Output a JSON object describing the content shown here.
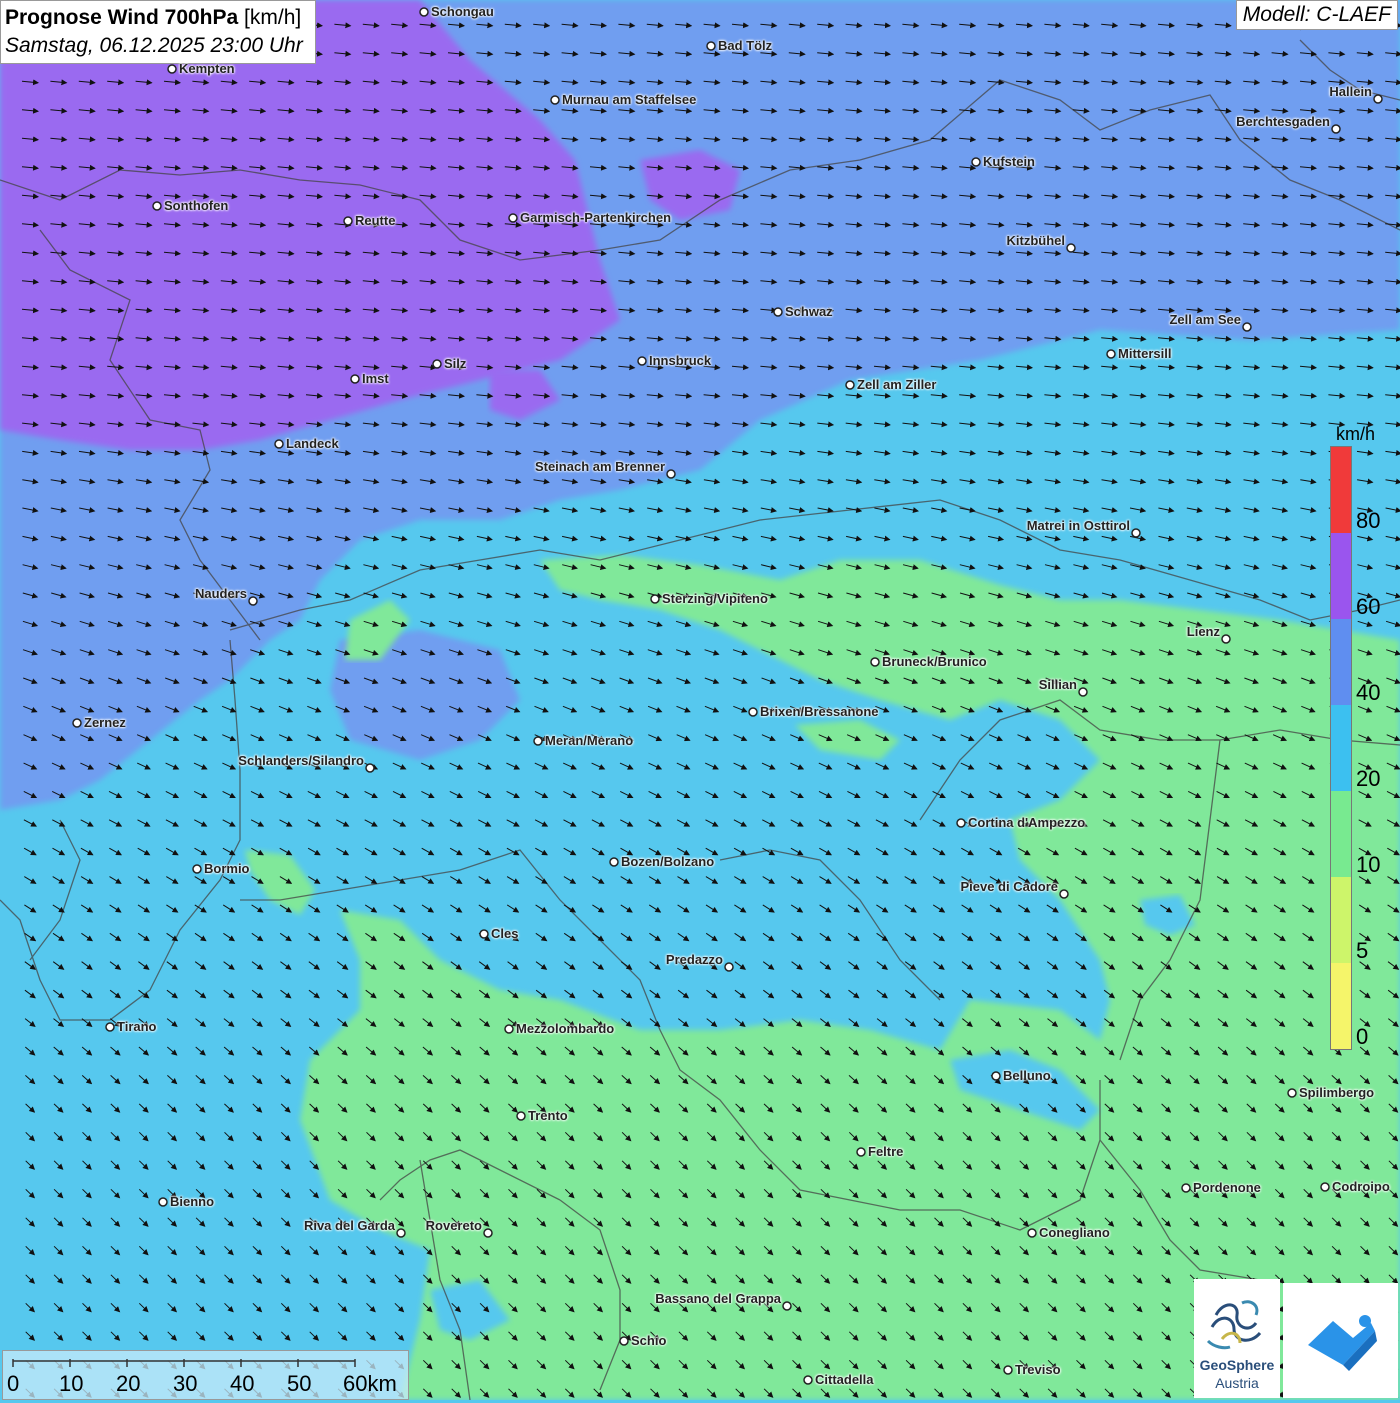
{
  "title": {
    "main": "Prognose Wind 700hPa",
    "unit": "[km/h]",
    "datetime": "Samstag, 06.12.2025 23:00 Uhr"
  },
  "model": "Modell: C-LAEF",
  "legend": {
    "unit": "km/h",
    "labels": [
      "80",
      "60",
      "40",
      "20",
      "10",
      "5",
      "0"
    ],
    "colors": [
      "#f03a3a",
      "#9a55ee",
      "#5f8ef0",
      "#3cc0f0",
      "#78ea90",
      "#cdf56a",
      "#f5f56a"
    ]
  },
  "scale": {
    "ticks": [
      "0",
      "10",
      "20",
      "30",
      "40",
      "50",
      "60km"
    ]
  },
  "logo": {
    "line1": "GeoSphere",
    "line2": "Austria"
  },
  "cities": [
    {
      "name": "Schongau",
      "side": "r"
    },
    {
      "name": "Bad Tölz",
      "side": "r"
    },
    {
      "name": "Kempten",
      "side": "r"
    },
    {
      "name": "Murnau am Staffelsee",
      "side": "r"
    },
    {
      "name": "Hallein",
      "side": "l"
    },
    {
      "name": "Berchtesgaden",
      "side": "l"
    },
    {
      "name": "Kufstein",
      "side": "r"
    },
    {
      "name": "Sonthofen",
      "side": "r"
    },
    {
      "name": "Reutte",
      "side": "r"
    },
    {
      "name": "Garmisch-Partenkirchen",
      "side": "r"
    },
    {
      "name": "Kitzbühel",
      "side": "l"
    },
    {
      "name": "Schwaz",
      "side": "r"
    },
    {
      "name": "Zell am See",
      "side": "l"
    },
    {
      "name": "Mittersill",
      "side": "r"
    },
    {
      "name": "Innsbruck",
      "side": "r"
    },
    {
      "name": "Silz",
      "side": "r"
    },
    {
      "name": "Imst",
      "side": "r"
    },
    {
      "name": "Zell am Ziller",
      "side": "r"
    },
    {
      "name": "Landeck",
      "side": "r"
    },
    {
      "name": "Steinach am Brenner",
      "side": "l"
    },
    {
      "name": "Matrei in Osttirol",
      "side": "l"
    },
    {
      "name": "Nauders",
      "side": "l"
    },
    {
      "name": "Sterzing/Vipiteno",
      "side": "r"
    },
    {
      "name": "Lienz",
      "side": "l"
    },
    {
      "name": "Bruneck/Brunico",
      "side": "r"
    },
    {
      "name": "Sillian",
      "side": "l"
    },
    {
      "name": "Brixen/Bressanone",
      "side": "r"
    },
    {
      "name": "Zernez",
      "side": "r"
    },
    {
      "name": "Meran/Merano",
      "side": "r"
    },
    {
      "name": "Schlanders/Silandro",
      "side": "l"
    },
    {
      "name": "Cortina d'Ampezzo",
      "side": "r"
    },
    {
      "name": "Bozen/Bolzano",
      "side": "r"
    },
    {
      "name": "Bormio",
      "side": "r"
    },
    {
      "name": "Pieve di Cadore",
      "side": "l"
    },
    {
      "name": "Cles",
      "side": "r"
    },
    {
      "name": "Predazzo",
      "side": "l"
    },
    {
      "name": "Tirano",
      "side": "r"
    },
    {
      "name": "Mezzolombardo",
      "side": "r"
    },
    {
      "name": "Belluno",
      "side": "r"
    },
    {
      "name": "Spilimbergo",
      "side": "r"
    },
    {
      "name": "Trento",
      "side": "r"
    },
    {
      "name": "Feltre",
      "side": "r"
    },
    {
      "name": "Pordenone",
      "side": "r"
    },
    {
      "name": "Codroipo",
      "side": "r"
    },
    {
      "name": "Bienno",
      "side": "r"
    },
    {
      "name": "Riva del Garda",
      "side": "l"
    },
    {
      "name": "Rovereto",
      "side": "l"
    },
    {
      "name": "Conegliano",
      "side": "r"
    },
    {
      "name": "Bassano del Grappa",
      "side": "l"
    },
    {
      "name": "Schio",
      "side": "r"
    },
    {
      "name": "Treviso",
      "side": "r"
    },
    {
      "name": "Cittadella",
      "side": "r"
    }
  ]
}
